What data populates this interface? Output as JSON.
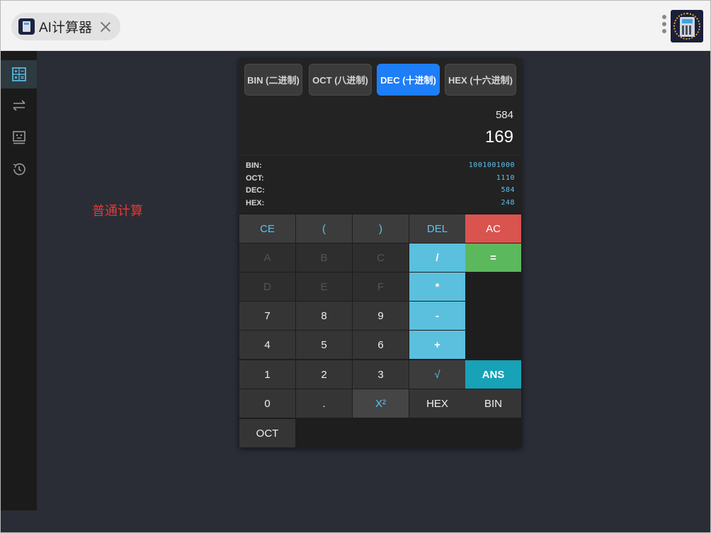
{
  "window": {
    "tab_title": "AI计算器",
    "tab_icon": "calculator-app-icon",
    "menu_icon": "more-vertical-icon",
    "logo_icon": "calculator-logo-icon"
  },
  "sidebar": {
    "items": [
      {
        "name": "calculator",
        "icon": "calculator-icon",
        "active": true
      },
      {
        "name": "convert",
        "icon": "swap-arrows-icon",
        "active": false
      },
      {
        "name": "ai-assistant",
        "icon": "robot-icon",
        "active": false
      },
      {
        "name": "history",
        "icon": "history-icon",
        "active": false
      }
    ]
  },
  "main": {
    "mode_label": "普通计算"
  },
  "calculator": {
    "base_tabs": [
      {
        "label": "BIN (二进制)",
        "active": false
      },
      {
        "label": "OCT (八进制)",
        "active": false
      },
      {
        "label": "DEC (十进制)",
        "active": true
      },
      {
        "label": "HEX (十六进制)",
        "active": false
      }
    ],
    "expression": "584",
    "result": "169",
    "conversions": [
      {
        "label": "BIN:",
        "value": "1001001000"
      },
      {
        "label": "OCT:",
        "value": "1110"
      },
      {
        "label": "DEC:",
        "value": "584"
      },
      {
        "label": "HEX:",
        "value": "248"
      }
    ],
    "keys": {
      "ce": "CE",
      "lparen": "(",
      "rparen": ")",
      "del": "DEL",
      "ac": "AC",
      "a": "A",
      "b": "B",
      "c": "C",
      "div": "/",
      "eq": "=",
      "d": "D",
      "e": "E",
      "f": "F",
      "mul": "*",
      "k7": "7",
      "k8": "8",
      "k9": "9",
      "sub": "-",
      "k4": "4",
      "k5": "5",
      "k6": "6",
      "add": "+",
      "k1": "1",
      "k2": "2",
      "k3": "3",
      "sqrt": "√",
      "ans": "ANS",
      "k0": "0",
      "dot": ".",
      "sq": "X²",
      "hex": "HEX",
      "bin": "BIN",
      "oct": "OCT"
    }
  },
  "colors": {
    "accent_blue": "#1e7ef7",
    "operator": "#5bc0de",
    "clear_red": "#d9534f",
    "equals_green": "#5cb85c",
    "ans_teal": "#17a2b8",
    "label_red": "#e53935"
  }
}
